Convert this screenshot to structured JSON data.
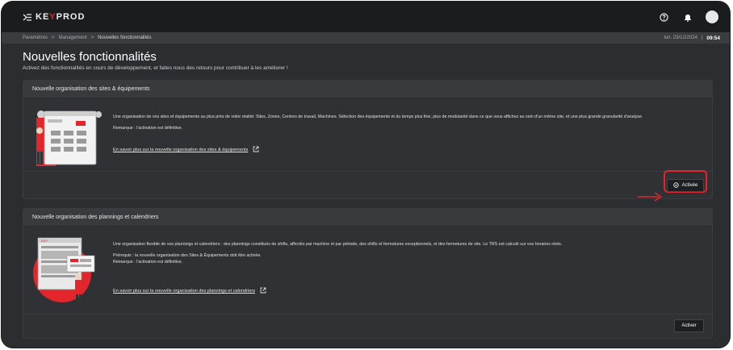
{
  "app": {
    "logo_left": "KE",
    "logo_accent": "Y",
    "logo_right": "PROD"
  },
  "breadcrumb": {
    "items": [
      "Paramètres",
      "Management",
      "Nouvelles fonctionnalités"
    ],
    "separator": ">"
  },
  "datetime": {
    "date": "lun. 23/12/2024",
    "separator": "|",
    "time": "09:54"
  },
  "page": {
    "title": "Nouvelles fonctionnalités",
    "subtitle": "Activez des fonctionnalités en cours de développement, et faites nous des retours pour contribuer à les améliorer !"
  },
  "cards": [
    {
      "title": "Nouvelle organisation des sites & équipements",
      "description": "Une organisation de vos sites et équipements au plus près de votre réalité: Sites, Zones, Centres de travail, Machines. Sélection des équipements et du temps plus fine, plus de modularité dans ce que vous affichez au sein d'un même site, et une plus grande granularité d'analyse.",
      "note": "Remarque : l'activation est définitive.",
      "link": "En savoir plus sur la nouvelle organisation des sites & équipements",
      "button_label": "Activée"
    },
    {
      "title": "Nouvelle organisation des plannings et calendriers",
      "description": "Une organisation flexible de vos plannings et calendriers : des plannings constitués de shifts, affectés par machine et par période, des shifts et fermetures exceptionnels, et des fermetures de site. Le TRS est calculé sur vos horaires réels.",
      "prereq": "Prérequis : la nouvelle organisation des Sites & Équipements doit être activée.",
      "note": "Remarque : l'activation est définitive.",
      "link": "En savoir plus sur la nouvelle organisation des  plannings et calendriers",
      "button_label": "Activer"
    }
  ],
  "colors": {
    "accent": "#e2262b",
    "background": "#2b2d30",
    "topbar": "#1b1c1e",
    "card": "#2f3134"
  },
  "icons": {
    "menu": "menu-icon",
    "help": "help-icon",
    "notifications": "bell-icon",
    "avatar": "avatar",
    "external_link": "external-link-icon",
    "check": "check-circle-icon",
    "arrow": "arrow-right-icon"
  }
}
